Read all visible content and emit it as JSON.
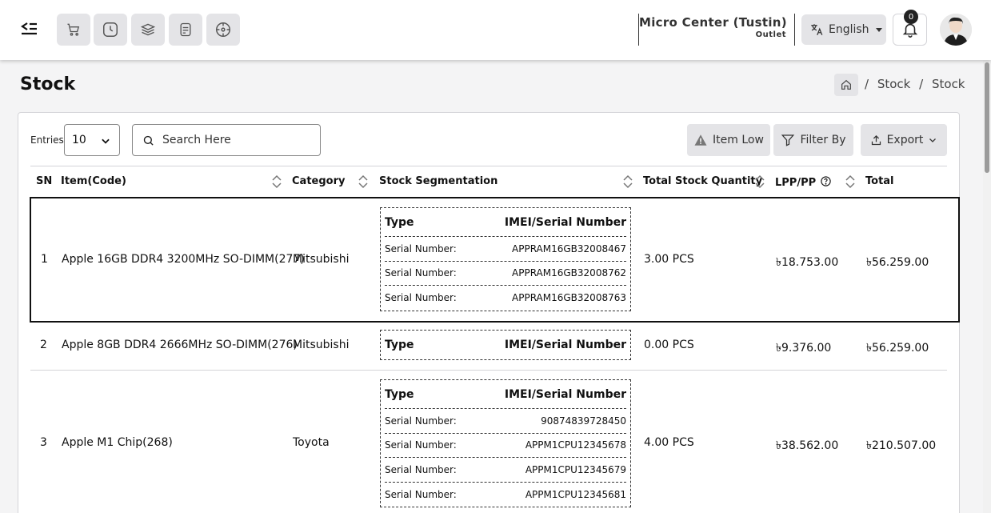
{
  "header": {
    "store_name": "Micro Center (Tustin)",
    "store_type": "Outlet",
    "language": "English",
    "notification_count": "0",
    "quick_icons": [
      "cart-icon",
      "clock-icon",
      "layers-icon",
      "report-icon",
      "dashboard-icon"
    ]
  },
  "page": {
    "title": "Stock",
    "breadcrumb": [
      "/",
      "Stock",
      "/",
      "Stock"
    ]
  },
  "toolbar": {
    "entries_label": "Entries",
    "entries_value": "10",
    "search_placeholder": "Search Here",
    "item_low_label": "Item Low",
    "filter_label": "Filter By",
    "export_label": "Export"
  },
  "table": {
    "columns": [
      "SN",
      "Item(Code)",
      "Category",
      "Stock Segmentation",
      "Total Stock Quantity",
      "LPP/PP",
      "Total"
    ],
    "seg_header": {
      "type": "Type",
      "serial": "IMEI/Serial Number"
    },
    "rows": [
      {
        "sn": "1",
        "item": "Apple 16GB DDR4 3200MHz SO-DIMM(277)",
        "category": "Mitsubishi",
        "segments": [
          {
            "type": "Serial Number:",
            "serial": "APPRAM16GB32008467"
          },
          {
            "type": "Serial Number:",
            "serial": "APPRAM16GB32008762"
          },
          {
            "type": "Serial Number:",
            "serial": "APPRAM16GB32008763"
          }
        ],
        "qty": "3.00 PCS",
        "lpp": "৳18.753.00",
        "total": "৳56.259.00"
      },
      {
        "sn": "2",
        "item": "Apple 8GB DDR4 2666MHz SO-DIMM(276)",
        "category": "Mitsubishi",
        "segments": [],
        "qty": "0.00 PCS",
        "lpp": "৳9.376.00",
        "total": "৳56.259.00"
      },
      {
        "sn": "3",
        "item": "Apple M1 Chip(268)",
        "category": "Toyota",
        "segments": [
          {
            "type": "Serial Number:",
            "serial": "90874839728450"
          },
          {
            "type": "Serial Number:",
            "serial": "APPM1CPU12345678"
          },
          {
            "type": "Serial Number:",
            "serial": "APPM1CPU12345679"
          },
          {
            "type": "Serial Number:",
            "serial": "APPM1CPU12345681"
          }
        ],
        "qty": "4.00 PCS",
        "lpp": "৳38.562.00",
        "total": "৳210.507.00"
      }
    ]
  }
}
